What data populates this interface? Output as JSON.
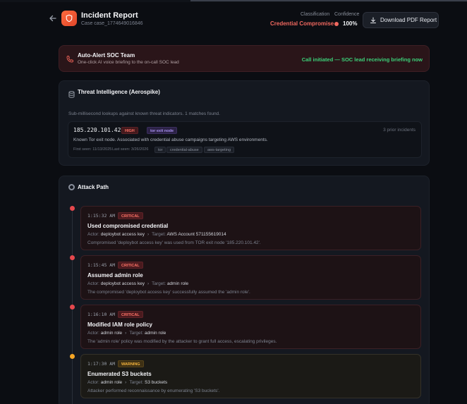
{
  "header": {
    "title": "Incident Report",
    "case_id": "Case case_1774649016846",
    "classification_label": "Classification",
    "classification_value": "Credential Compromise",
    "confidence_label": "Confidence",
    "confidence_value": "100%",
    "download_label": "Download PDF Report"
  },
  "alert": {
    "title": "Auto-Alert SOC Team",
    "subtitle": "One-click AI voice briefing to the on-call SOC lead",
    "status": "Call initiated — SOC lead receiving briefing now"
  },
  "threat_intel": {
    "title": "Threat Intelligence (Aerospike)",
    "description": "Sub-millisecond lookups against known threat indicators. 1 matches found.",
    "indicator": {
      "ip": "185.220.101.42",
      "severity": "HIGH",
      "type": "tor exit node",
      "prior": "3 prior incidents",
      "description": "Known Tor exit node. Associated with credential abuse campaigns targeting AWS environments.",
      "first_seen": "First seen: 11/13/2025",
      "last_seen": "Last seen: 3/26/2026",
      "tags": [
        "tor",
        "credential-abuse",
        "aws-targeting"
      ]
    }
  },
  "attack_path": {
    "title": "Attack Path",
    "actor_label": "Actor:",
    "target_label": "Target:",
    "events": [
      {
        "time": "1:15:32 AM",
        "severity": "CRITICAL",
        "title": "Used compromised credential",
        "actor": "deploybot access key",
        "target": "AWS Account 571155619014",
        "description": "Compromised 'deploybot access key' was used from TOR exit node '185.220.101.42'."
      },
      {
        "time": "1:15:45 AM",
        "severity": "CRITICAL",
        "title": "Assumed admin role",
        "actor": "deploybot access key",
        "target": "admin role",
        "description": "The compromised 'deploybot access key' successfully assumed the 'admin role'."
      },
      {
        "time": "1:16:10 AM",
        "severity": "CRITICAL",
        "title": "Modified IAM role policy",
        "actor": "admin role",
        "target": "admin role",
        "description": "The 'admin role' policy was modified by the attacker to grant full access, escalating privileges."
      },
      {
        "time": "1:17:30 AM",
        "severity": "WARNING",
        "title": "Enumerated S3 buckets",
        "actor": "admin role",
        "target": "S3 buckets",
        "description": "Attacker performed reconnaissance by enumerating 'S3 buckets'."
      }
    ]
  },
  "colors": {
    "critical": "#e5484d",
    "warning": "#f5a524",
    "accent": "#ff6a3d",
    "success": "#3ccf78"
  }
}
